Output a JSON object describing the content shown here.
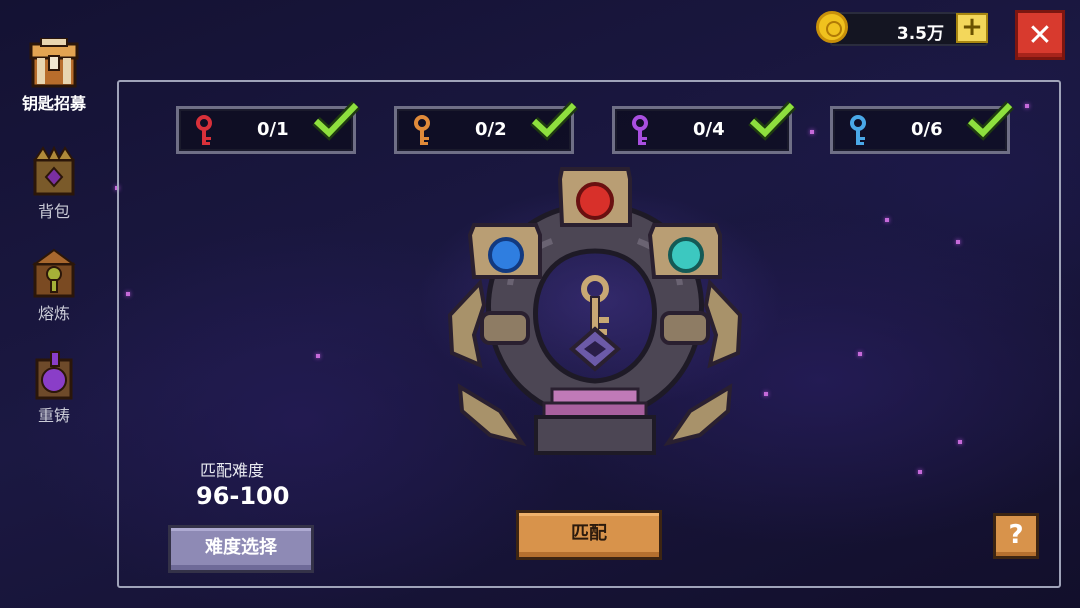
{
  "currency": {
    "value": "3.5万",
    "plus_label": "+",
    "icon": "gold-coin-icon"
  },
  "close": {
    "label": "✕",
    "icon": "close-icon"
  },
  "sidebar": {
    "items": [
      {
        "label": "钥匙招募",
        "icon": "treasure-chest-icon",
        "active": true
      },
      {
        "label": "背包",
        "icon": "backpack-icon",
        "active": false
      },
      {
        "label": "熔炼",
        "icon": "smelting-icon",
        "active": false
      },
      {
        "label": "重铸",
        "icon": "reforge-icon",
        "active": false
      }
    ]
  },
  "keys": [
    {
      "count": "0/1",
      "color": "#d8303a",
      "icon": "red-key-icon",
      "checked": true
    },
    {
      "count": "0/2",
      "color": "#e08a3a",
      "icon": "orange-key-icon",
      "checked": true
    },
    {
      "count": "0/4",
      "color": "#a94fe0",
      "icon": "purple-key-icon",
      "checked": true
    },
    {
      "count": "0/6",
      "color": "#4aa8e8",
      "icon": "blue-key-icon",
      "checked": true
    }
  ],
  "difficulty": {
    "title": "匹配难度",
    "range": "96-100",
    "select_label": "难度选择"
  },
  "match": {
    "label": "匹配"
  },
  "help": {
    "label": "?"
  },
  "colors": {
    "check": "#8ee03e",
    "accent_orange": "#d8934b",
    "accent_purple": "#8e8ab5",
    "close_red": "#d83a2e"
  }
}
